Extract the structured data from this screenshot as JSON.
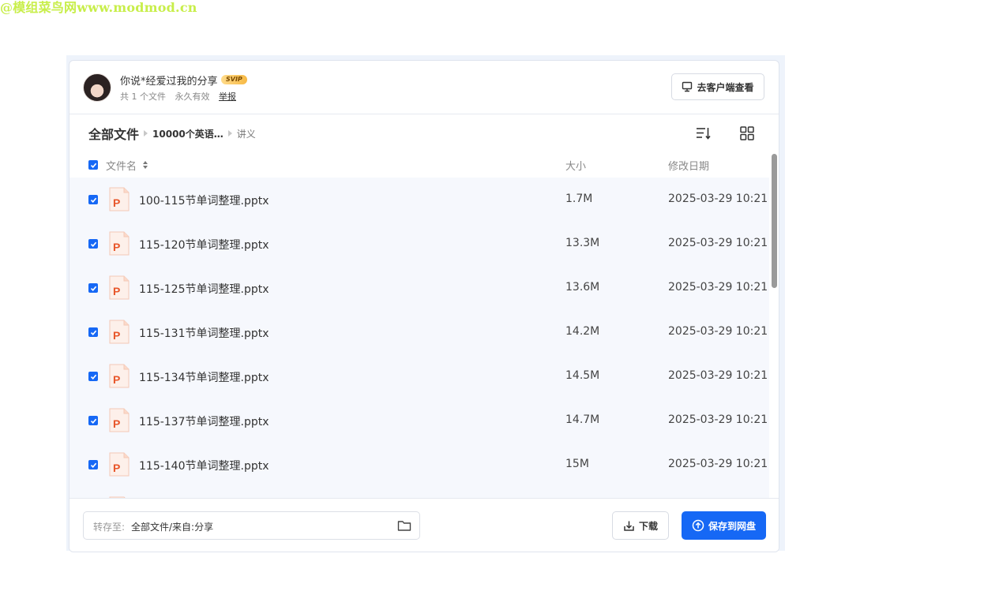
{
  "watermark": "@模组菜鸟网www.modmod.cn",
  "share": {
    "title": "你说*经爱过我的分享",
    "badge": "SVIP",
    "file_count": "共 1 个文件",
    "validity": "永久有效",
    "report": "举报",
    "client_button": "去客户端查看"
  },
  "breadcrumb": {
    "root": "全部文件",
    "middle": "10000个英语…",
    "current": "讲义"
  },
  "columns": {
    "name": "文件名",
    "size": "大小",
    "modified": "修改日期"
  },
  "files": [
    {
      "name": "100-115节单词整理.pptx",
      "size": "1.7M",
      "date": "2025-03-29 10:21"
    },
    {
      "name": "115-120节单词整理.pptx",
      "size": "13.3M",
      "date": "2025-03-29 10:21"
    },
    {
      "name": "115-125节单词整理.pptx",
      "size": "13.6M",
      "date": "2025-03-29 10:21"
    },
    {
      "name": "115-131节单词整理.pptx",
      "size": "14.2M",
      "date": "2025-03-29 10:21"
    },
    {
      "name": "115-134节单词整理.pptx",
      "size": "14.5M",
      "date": "2025-03-29 10:21"
    },
    {
      "name": "115-137节单词整理.pptx",
      "size": "14.7M",
      "date": "2025-03-29 10:21"
    },
    {
      "name": "115-140节单词整理.pptx",
      "size": "15M",
      "date": "2025-03-29 10:21"
    }
  ],
  "footer": {
    "save_label": "转存至:",
    "save_path": "全部文件/来自:分享",
    "download": "下载",
    "save_to_disk": "保存到网盘"
  },
  "colors": {
    "accent": "#1668f5",
    "row_bg": "#f6f8fd",
    "ppt_icon": "#e8562a"
  }
}
